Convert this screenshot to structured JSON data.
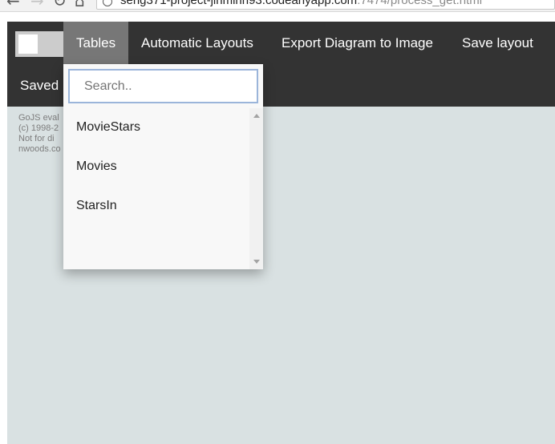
{
  "browser": {
    "url_host": "seng371-project-jinminn93.codeanyapp.com",
    "url_path": ":7474/process_get.html"
  },
  "navbar": {
    "items": [
      {
        "label": "Tables"
      },
      {
        "label": "Automatic Layouts"
      },
      {
        "label": "Export Diagram to Image"
      },
      {
        "label": "Save layout"
      },
      {
        "label": "Saved l"
      }
    ]
  },
  "dropdown": {
    "search_placeholder": "Search..",
    "items": [
      "MovieStars",
      "Movies",
      "StarsIn"
    ]
  },
  "watermark": {
    "lines": [
      "GoJS eval",
      "(c) 1998-2",
      "Not for di",
      "nwoods.co"
    ]
  },
  "colors": {
    "navbar_bg": "#333333",
    "active_tab_bg": "#777777",
    "canvas_bg": "#d9e1e2",
    "dropdown_bg": "#f8f8f8",
    "search_border": "#9bb5da"
  },
  "icons": [
    "back-arrow-icon",
    "forward-arrow-icon",
    "reload-icon",
    "home-icon",
    "info-icon",
    "scroll-up-icon",
    "scroll-down-icon"
  ]
}
